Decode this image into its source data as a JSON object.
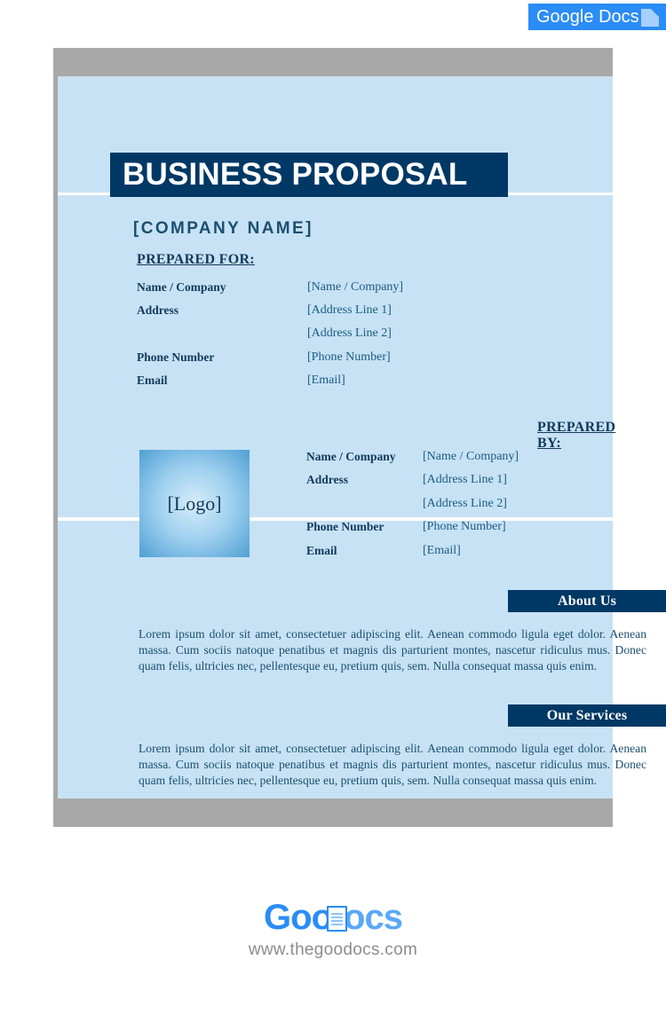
{
  "badge": {
    "brand_first": "Google",
    "brand_second": "Docs",
    "accent_color": "#2a8cf6"
  },
  "document": {
    "title": "BUSINESS PROPOSAL",
    "company_name": "[COMPANY NAME]",
    "accent_dark": "#003865",
    "page_background": "#c7e2f4",
    "band_gray": "#a8a8a8"
  },
  "prepared_for": {
    "label": "PREPARED FOR:",
    "rows": [
      {
        "label": "Name / Company",
        "value": "[Name / Company]"
      },
      {
        "label": "Address",
        "value": "[Address Line 1]"
      },
      {
        "label": "",
        "value": "[Address Line 2]"
      },
      {
        "label": "Phone Number",
        "value": "[Phone Number]"
      },
      {
        "label": "Email",
        "value": "[Email]"
      }
    ]
  },
  "prepared_by": {
    "label": "PREPARED BY:",
    "logo_placeholder": "[Logo]",
    "rows": [
      {
        "label": "Name / Company",
        "value": "[Name / Company]"
      },
      {
        "label": "Address",
        "value": "[Address Line 1]"
      },
      {
        "label": "",
        "value": "[Address Line 2]"
      },
      {
        "label": "Phone Number",
        "value": "[Phone Number]"
      },
      {
        "label": "Email",
        "value": "[Email]"
      }
    ]
  },
  "sections": {
    "about": {
      "title": "About Us",
      "body": "Lorem ipsum dolor sit amet, consectetuer adipiscing elit. Aenean commodo ligula eget dolor. Aenean massa. Cum sociis natoque penatibus et magnis dis parturient montes, nascetur ridiculus mus. Donec quam felis, ultricies nec, pellentesque eu, pretium quis, sem. Nulla consequat massa quis enim."
    },
    "services": {
      "title": "Our Services",
      "body": "Lorem ipsum dolor sit amet, consectetuer adipiscing elit. Aenean commodo ligula eget dolor. Aenean massa. Cum sociis natoque penatibus et magnis dis parturient montes, nascetur ridiculus mus. Donec quam felis, ultricies nec, pellentesque eu, pretium quis, sem. Nulla consequat massa quis enim."
    }
  },
  "footer": {
    "logo_part_one": "Goo",
    "logo_part_two": "ocs",
    "url": "www.thegoodocs.com"
  }
}
